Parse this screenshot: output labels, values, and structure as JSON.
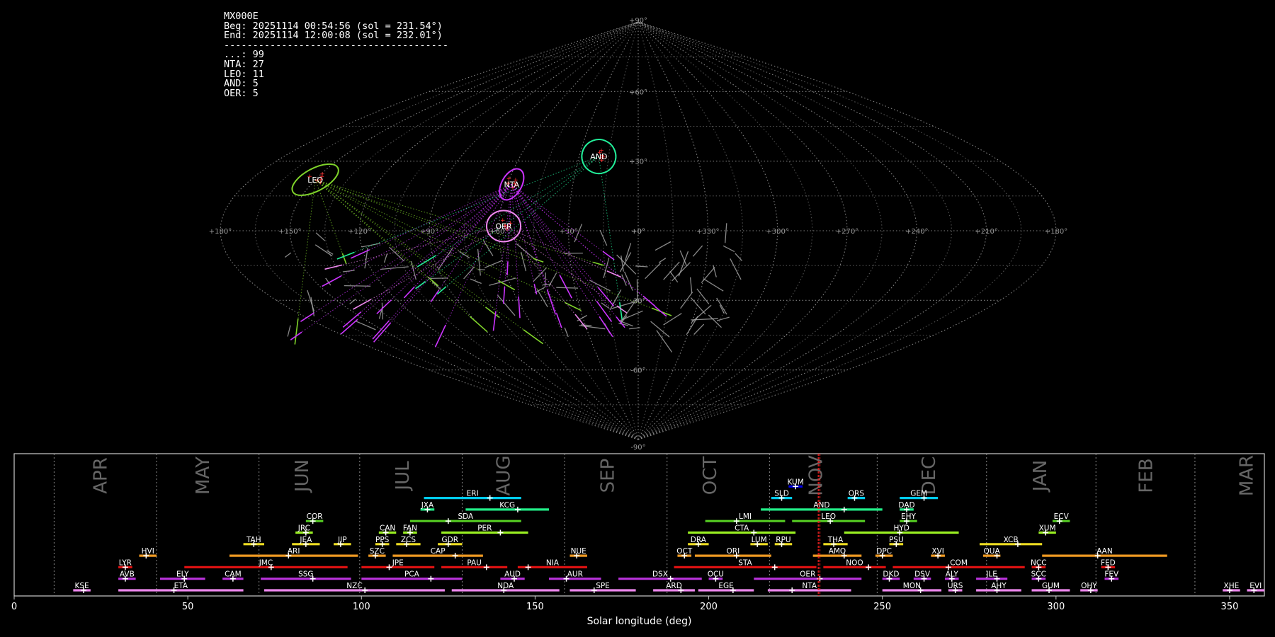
{
  "info": {
    "station": "MX000E",
    "beg": "Beg: 20251114 00:54:56 (sol = 231.54°)",
    "end": "End: 20251114 12:00:08 (sol = 232.01°)",
    "sep": "---------------------------------------",
    "counts": [
      "...: 99",
      "NTA: 27",
      "LEO: 11",
      "AND: 5",
      "OER: 5"
    ]
  },
  "chart_data": [
    {
      "type": "scatter",
      "projection": "sinusoidal",
      "lon_ticks": [
        180,
        150,
        120,
        90,
        60,
        30,
        0,
        330,
        300,
        270,
        240,
        210,
        180
      ],
      "lat_ticks": [
        90,
        60,
        30,
        0,
        -30,
        -60,
        -90
      ],
      "lon_tick_labels": [
        "+180°",
        "+150°",
        "+120°",
        "+90°",
        "+60°",
        "+30°",
        "+0°",
        "+330°",
        "+300°",
        "+270°",
        "+240°",
        "+210°",
        "+180°"
      ],
      "lat_tick_labels": [
        "+90°",
        "+60°",
        "+30°",
        "+0°",
        "-30°",
        "-60°",
        "-90°"
      ],
      "grid": true,
      "radiants": [
        {
          "name": "LEO",
          "lon": 150,
          "lat": 22,
          "color": "#7fd32a"
        },
        {
          "name": "NTA",
          "lon": 58,
          "lat": 20,
          "color": "#cc33ff"
        },
        {
          "name": "AND",
          "lon": 20,
          "lat": 32,
          "color": "#22ee99"
        },
        {
          "name": "OER",
          "lon": 58,
          "lat": 2,
          "color": "#ee88ee"
        }
      ],
      "series": [
        {
          "name": "LEO",
          "count": 11,
          "color": "#7fd32a"
        },
        {
          "name": "NTA",
          "count": 27,
          "color": "#cc33ff"
        },
        {
          "name": "AND",
          "count": 5,
          "color": "#22ee99"
        },
        {
          "name": "OER",
          "count": 5,
          "color": "#ee88ee"
        },
        {
          "name": "...",
          "count": 99,
          "color": "#bbbbbb"
        }
      ]
    },
    {
      "type": "bar",
      "xlabel": "Solar longitude (deg)",
      "xlim": [
        0,
        360
      ],
      "x_ticks": [
        0,
        50,
        100,
        150,
        200,
        250,
        300,
        350
      ],
      "current_sol": [
        231.54,
        232.01
      ],
      "months": [
        {
          "name": "APR",
          "sol": 25,
          "boundary": 11.5
        },
        {
          "name": "MAY",
          "sol": 54.5,
          "boundary": 41
        },
        {
          "name": "JUN",
          "sol": 83,
          "boundary": 70.5
        },
        {
          "name": "JUL",
          "sol": 112,
          "boundary": 99.5
        },
        {
          "name": "AUG",
          "sol": 141,
          "boundary": 129
        },
        {
          "name": "SEP",
          "sol": 171,
          "boundary": 158.5
        },
        {
          "name": "OCT",
          "sol": 200.5,
          "boundary": 188
        },
        {
          "name": "NOV",
          "sol": 231,
          "boundary": 217.5
        },
        {
          "name": "DEC",
          "sol": 263.5,
          "boundary": 248.5
        },
        {
          "name": "JAN",
          "sol": 295.5,
          "boundary": 280
        },
        {
          "name": "FEB",
          "sol": 326,
          "boundary": 311.5
        },
        {
          "name": "MAR",
          "sol": 355,
          "boundary": 340
        }
      ],
      "showers": [
        {
          "name": "KUM",
          "start": 223,
          "end": 227,
          "peak": 225,
          "row": 9,
          "color": "#0000ee"
        },
        {
          "name": "ERI",
          "start": 118,
          "end": 146,
          "peak": 137,
          "row": 8,
          "color": "#00ccee"
        },
        {
          "name": "SLD",
          "start": 218,
          "end": 224,
          "peak": 221,
          "row": 8,
          "color": "#00ccee"
        },
        {
          "name": "ORS",
          "start": 240,
          "end": 245,
          "peak": 242,
          "row": 8,
          "color": "#00ccee"
        },
        {
          "name": "GEM",
          "start": 255,
          "end": 266,
          "peak": 262,
          "row": 8,
          "color": "#00ccee"
        },
        {
          "name": "JXA",
          "start": 117,
          "end": 121,
          "peak": 119,
          "row": 7,
          "color": "#22ee88"
        },
        {
          "name": "KCG",
          "start": 130,
          "end": 154,
          "peak": 145,
          "row": 7,
          "color": "#22ee88"
        },
        {
          "name": "AND",
          "start": 215,
          "end": 250,
          "peak": 239,
          "row": 7,
          "color": "#22ee88"
        },
        {
          "name": "DAD",
          "start": 255,
          "end": 259,
          "peak": 257,
          "row": 7,
          "color": "#22ee88"
        },
        {
          "name": "COR",
          "start": 84,
          "end": 89,
          "peak": 86,
          "row": 6,
          "color": "#55cc22"
        },
        {
          "name": "SDA",
          "start": 114,
          "end": 146,
          "peak": 125,
          "row": 6,
          "color": "#55cc22"
        },
        {
          "name": "LMI",
          "start": 199,
          "end": 222,
          "peak": 208,
          "row": 6,
          "color": "#55cc22"
        },
        {
          "name": "LEO",
          "start": 224,
          "end": 245,
          "peak": 235,
          "row": 6,
          "color": "#55cc22"
        },
        {
          "name": "EHY",
          "start": 255,
          "end": 260,
          "peak": 257,
          "row": 6,
          "color": "#55cc22"
        },
        {
          "name": "ECV",
          "start": 299,
          "end": 304,
          "peak": 301,
          "row": 6,
          "color": "#55cc22"
        },
        {
          "name": "JRC",
          "start": 81,
          "end": 86,
          "peak": 84,
          "row": 5,
          "color": "#99ee22"
        },
        {
          "name": "CAN",
          "start": 105,
          "end": 110,
          "peak": 107,
          "row": 5,
          "color": "#99ee22"
        },
        {
          "name": "FAN",
          "start": 112,
          "end": 116,
          "peak": 114,
          "row": 5,
          "color": "#99ee22"
        },
        {
          "name": "PER",
          "start": 123,
          "end": 148,
          "peak": 140,
          "row": 5,
          "color": "#99ee22"
        },
        {
          "name": "CTA",
          "start": 194,
          "end": 225,
          "peak": 213,
          "row": 5,
          "color": "#99ee22"
        },
        {
          "name": "HYD",
          "start": 239,
          "end": 272,
          "peak": 255,
          "row": 5,
          "color": "#99ee22"
        },
        {
          "name": "XUM",
          "start": 295,
          "end": 300,
          "peak": 297,
          "row": 5,
          "color": "#99ee22"
        },
        {
          "name": "TAH",
          "start": 66,
          "end": 72,
          "peak": 69,
          "row": 4,
          "color": "#eedd22"
        },
        {
          "name": "JEA",
          "start": 80,
          "end": 88,
          "peak": 84,
          "row": 4,
          "color": "#eedd22"
        },
        {
          "name": "JIP",
          "start": 92,
          "end": 97,
          "peak": 94,
          "row": 4,
          "color": "#eedd22"
        },
        {
          "name": "PPS",
          "start": 104,
          "end": 108,
          "peak": 106,
          "row": 4,
          "color": "#eedd22"
        },
        {
          "name": "ZCS",
          "start": 110,
          "end": 117,
          "peak": 113,
          "row": 4,
          "color": "#eedd22"
        },
        {
          "name": "GDR",
          "start": 122,
          "end": 129,
          "peak": 125,
          "row": 4,
          "color": "#eedd22"
        },
        {
          "name": "DRA",
          "start": 194,
          "end": 200,
          "peak": 197,
          "row": 4,
          "color": "#eedd22"
        },
        {
          "name": "LUM",
          "start": 212,
          "end": 217,
          "peak": 214,
          "row": 4,
          "color": "#eedd22"
        },
        {
          "name": "RPU",
          "start": 219,
          "end": 224,
          "peak": 221,
          "row": 4,
          "color": "#eedd22"
        },
        {
          "name": "THA",
          "start": 233,
          "end": 240,
          "peak": 236,
          "row": 4,
          "color": "#eedd22"
        },
        {
          "name": "PSU",
          "start": 252,
          "end": 256,
          "peak": 254,
          "row": 4,
          "color": "#eedd22"
        },
        {
          "name": "XCB",
          "start": 278,
          "end": 296,
          "peak": 289,
          "row": 4,
          "color": "#eedd22"
        },
        {
          "name": "HVI",
          "start": 36,
          "end": 41,
          "peak": 38,
          "row": 3,
          "color": "#ee9922"
        },
        {
          "name": "ARI",
          "start": 62,
          "end": 99,
          "peak": 79,
          "row": 3,
          "color": "#ee9922"
        },
        {
          "name": "SZC",
          "start": 102,
          "end": 107,
          "peak": 104,
          "row": 3,
          "color": "#ee9922"
        },
        {
          "name": "CAP",
          "start": 109,
          "end": 135,
          "peak": 127,
          "row": 3,
          "color": "#ee9922"
        },
        {
          "name": "NUE",
          "start": 160,
          "end": 165,
          "peak": 162,
          "row": 3,
          "color": "#ee9922"
        },
        {
          "name": "OCT",
          "start": 191,
          "end": 195,
          "peak": 193,
          "row": 3,
          "color": "#ee9922"
        },
        {
          "name": "ORI",
          "start": 196,
          "end": 218,
          "peak": 208,
          "row": 3,
          "color": "#ee9922"
        },
        {
          "name": "AMO",
          "start": 230,
          "end": 244,
          "peak": 239,
          "row": 3,
          "color": "#ee9922"
        },
        {
          "name": "DPC",
          "start": 248,
          "end": 253,
          "peak": 250,
          "row": 3,
          "color": "#ee9922"
        },
        {
          "name": "XVI",
          "start": 264,
          "end": 268,
          "peak": 266,
          "row": 3,
          "color": "#ee9922"
        },
        {
          "name": "QUA",
          "start": 279,
          "end": 284,
          "peak": 283,
          "row": 3,
          "color": "#ee9922"
        },
        {
          "name": "AAN",
          "start": 296,
          "end": 332,
          "peak": 312,
          "row": 3,
          "color": "#ee9922"
        },
        {
          "name": "LYR",
          "start": 30,
          "end": 34,
          "peak": 32,
          "row": 2,
          "color": "#dd1111"
        },
        {
          "name": "JMC",
          "start": 49,
          "end": 96,
          "peak": 74,
          "row": 2,
          "color": "#dd1111"
        },
        {
          "name": "JPE",
          "start": 100,
          "end": 121,
          "peak": 108,
          "row": 2,
          "color": "#dd1111"
        },
        {
          "name": "PAU",
          "start": 123,
          "end": 142,
          "peak": 136,
          "row": 2,
          "color": "#dd1111"
        },
        {
          "name": "NIA",
          "start": 145,
          "end": 165,
          "peak": 148,
          "row": 2,
          "color": "#dd1111"
        },
        {
          "name": "STA",
          "start": 190,
          "end": 231,
          "peak": 219,
          "row": 2,
          "color": "#dd1111"
        },
        {
          "name": "NOO",
          "start": 233,
          "end": 251,
          "peak": 246,
          "row": 2,
          "color": "#dd1111"
        },
        {
          "name": "COM",
          "start": 253,
          "end": 291,
          "peak": 269,
          "row": 2,
          "color": "#dd1111"
        },
        {
          "name": "NCC",
          "start": 293,
          "end": 297,
          "peak": 295,
          "row": 2,
          "color": "#dd1111"
        },
        {
          "name": "FED",
          "start": 313,
          "end": 317,
          "peak": 315,
          "row": 2,
          "color": "#dd1111"
        },
        {
          "name": "AVB",
          "start": 30,
          "end": 35,
          "peak": 32,
          "row": 1,
          "color": "#bb33dd"
        },
        {
          "name": "ELY",
          "start": 42,
          "end": 55,
          "peak": 49,
          "row": 1,
          "color": "#bb33dd"
        },
        {
          "name": "CAM",
          "start": 60,
          "end": 66,
          "peak": 63,
          "row": 1,
          "color": "#bb33dd"
        },
        {
          "name": "SSG",
          "start": 71,
          "end": 97,
          "peak": 86,
          "row": 1,
          "color": "#bb33dd"
        },
        {
          "name": "PCA",
          "start": 100,
          "end": 129,
          "peak": 120,
          "row": 1,
          "color": "#bb33dd"
        },
        {
          "name": "AUD",
          "start": 140,
          "end": 147,
          "peak": 144,
          "row": 1,
          "color": "#bb33dd"
        },
        {
          "name": "AUR",
          "start": 154,
          "end": 169,
          "peak": 159,
          "row": 1,
          "color": "#bb33dd"
        },
        {
          "name": "DSX",
          "start": 174,
          "end": 198,
          "peak": 189,
          "row": 1,
          "color": "#bb33dd"
        },
        {
          "name": "OCU",
          "start": 200,
          "end": 204,
          "peak": 202,
          "row": 1,
          "color": "#bb33dd"
        },
        {
          "name": "OER",
          "start": 213,
          "end": 244,
          "peak": 232,
          "row": 1,
          "color": "#bb33dd"
        },
        {
          "name": "DKD",
          "start": 250,
          "end": 255,
          "peak": 252,
          "row": 1,
          "color": "#bb33dd"
        },
        {
          "name": "DSV",
          "start": 259,
          "end": 264,
          "peak": 262,
          "row": 1,
          "color": "#bb33dd"
        },
        {
          "name": "ALY",
          "start": 268,
          "end": 272,
          "peak": 270,
          "row": 1,
          "color": "#bb33dd"
        },
        {
          "name": "JLE",
          "start": 277,
          "end": 286,
          "peak": 283,
          "row": 1,
          "color": "#bb33dd"
        },
        {
          "name": "SCC",
          "start": 293,
          "end": 297,
          "peak": 295,
          "row": 1,
          "color": "#bb33dd"
        },
        {
          "name": "FEV",
          "start": 314,
          "end": 318,
          "peak": 316,
          "row": 1,
          "color": "#bb33dd"
        },
        {
          "name": "KSE",
          "start": 17,
          "end": 22,
          "peak": 20,
          "row": 0,
          "color": "#ee88ee"
        },
        {
          "name": "ETA",
          "start": 30,
          "end": 66,
          "peak": 46,
          "row": 0,
          "color": "#ee88ee"
        },
        {
          "name": "NZC",
          "start": 72,
          "end": 124,
          "peak": 101,
          "row": 0,
          "color": "#ee88ee"
        },
        {
          "name": "NDA",
          "start": 126,
          "end": 157,
          "peak": 141,
          "row": 0,
          "color": "#ee88ee"
        },
        {
          "name": "SPE",
          "start": 160,
          "end": 179,
          "peak": 167,
          "row": 0,
          "color": "#ee88ee"
        },
        {
          "name": "ARD",
          "start": 184,
          "end": 196,
          "peak": 192,
          "row": 0,
          "color": "#ee88ee"
        },
        {
          "name": "EGE",
          "start": 197,
          "end": 213,
          "peak": 207,
          "row": 0,
          "color": "#ee88ee"
        },
        {
          "name": "NTA",
          "start": 217,
          "end": 241,
          "peak": 224,
          "row": 0,
          "color": "#ee88ee"
        },
        {
          "name": "MON",
          "start": 250,
          "end": 267,
          "peak": 261,
          "row": 0,
          "color": "#ee88ee"
        },
        {
          "name": "URS",
          "start": 269,
          "end": 273,
          "peak": 271,
          "row": 0,
          "color": "#ee88ee"
        },
        {
          "name": "AHY",
          "start": 277,
          "end": 290,
          "peak": 283,
          "row": 0,
          "color": "#ee88ee"
        },
        {
          "name": "GUM",
          "start": 293,
          "end": 304,
          "peak": 298,
          "row": 0,
          "color": "#ee88ee"
        },
        {
          "name": "OHY",
          "start": 307,
          "end": 312,
          "peak": 310,
          "row": 0,
          "color": "#ee88ee"
        },
        {
          "name": "XHE",
          "start": 348,
          "end": 353,
          "peak": 350,
          "row": 0,
          "color": "#ee88ee"
        },
        {
          "name": "EVI",
          "start": 355,
          "end": 360,
          "peak": 357,
          "row": 0,
          "color": "#ee88ee"
        }
      ]
    }
  ]
}
